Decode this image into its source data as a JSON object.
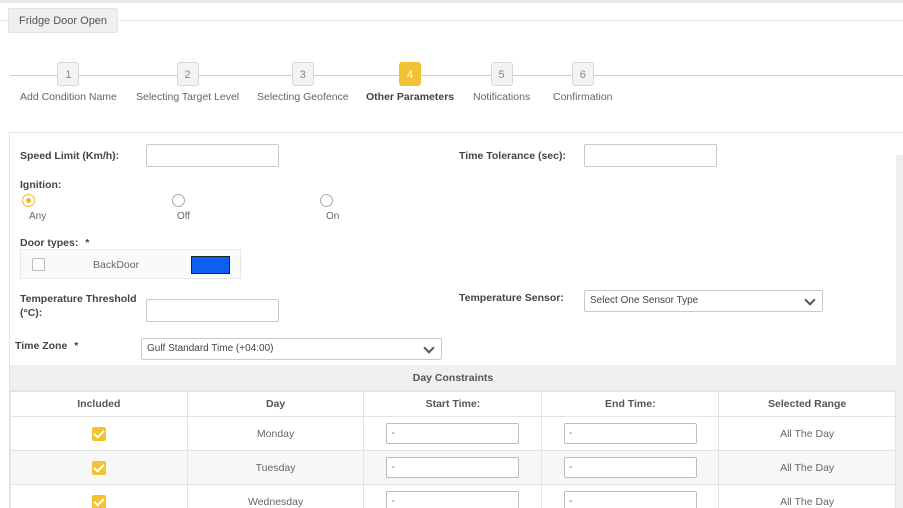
{
  "top_tab": "Fridge Door Open",
  "steps": [
    {
      "num": "1",
      "label": "Add Condition Name"
    },
    {
      "num": "2",
      "label": "Selecting Target Level"
    },
    {
      "num": "3",
      "label": "Selecting Geofence"
    },
    {
      "num": "4",
      "label": "Other Parameters"
    },
    {
      "num": "5",
      "label": "Notifications"
    },
    {
      "num": "6",
      "label": "Confirmation"
    }
  ],
  "active_step": 4,
  "form": {
    "speed_limit_label": "Speed Limit (Km/h):",
    "speed_limit_value": "",
    "time_tolerance_label": "Time Tolerance (sec):",
    "time_tolerance_value": "",
    "ignition_label": "Ignition:",
    "ignition_options": [
      "Any",
      "Off",
      "On"
    ],
    "ignition_selected": "Any",
    "door_types_label": "Door types:",
    "required_mark": "*",
    "door_type": {
      "name": "BackDoor",
      "checked": false,
      "color": "#0d5ff2"
    },
    "temp_threshold_label_line1": "Temperature Threshold",
    "temp_threshold_label_line2": "(°C):",
    "temp_threshold_value": "",
    "temp_sensor_label": "Temperature Sensor:",
    "temp_sensor_value": "Select One Sensor Type",
    "time_zone_label": "Time Zone",
    "time_zone_value": "Gulf Standard Time (+04:00)"
  },
  "day_constraints": {
    "title": "Day Constraints",
    "columns": [
      "Included",
      "Day",
      "Start Time:",
      "End Time:",
      "Selected Range"
    ],
    "rows": [
      {
        "included": true,
        "day": "Monday",
        "start": "-",
        "end": "-",
        "range": "All The Day"
      },
      {
        "included": true,
        "day": "Tuesday",
        "start": "-",
        "end": "-",
        "range": "All The Day"
      },
      {
        "included": true,
        "day": "Wednesday",
        "start": "-",
        "end": "-",
        "range": "All The Day"
      }
    ]
  },
  "colors": {
    "accent": "#f3c232",
    "door_swatch": "#0d5ff2"
  }
}
